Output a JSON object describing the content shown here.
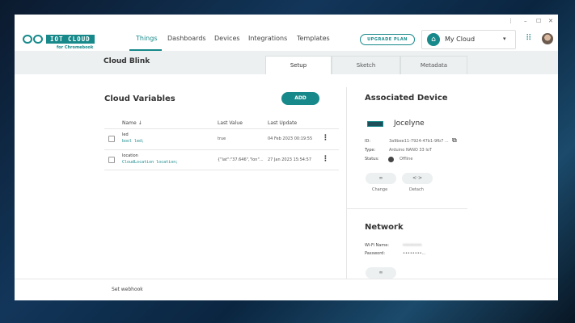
{
  "window": {
    "kebab": "⋮",
    "minimize": "–",
    "maximize": "☐",
    "close": "✕"
  },
  "logo": {
    "text": "IOT CLOUD",
    "sub": "for Chromebook"
  },
  "nav": [
    {
      "label": "Things"
    },
    {
      "label": "Dashboards"
    },
    {
      "label": "Devices"
    },
    {
      "label": "Integrations"
    },
    {
      "label": "Templates"
    }
  ],
  "header": {
    "upgrade": "UPGRADE PLAN",
    "cloud": "My Cloud",
    "caret": "▾",
    "apps": "⠿"
  },
  "thing": {
    "title": "Cloud Blink",
    "tabs": [
      "Setup",
      "Sketch",
      "Metadata"
    ]
  },
  "variables": {
    "title": "Cloud Variables",
    "add": "ADD",
    "columns": [
      "Name ↓",
      "Last Value",
      "Last Update"
    ],
    "rows": [
      {
        "name": "led",
        "code": "bool led;",
        "value": "true",
        "updated": "04 Feb 2023 00:19:55"
      },
      {
        "name": "location",
        "code": "CloudLocation location;",
        "value": "{\"lat\":\"37.646\",\"lon\"...",
        "updated": "27 Jan 2023 15:54:57"
      }
    ]
  },
  "device": {
    "title": "Associated Device",
    "name": "Jocelyne",
    "id_label": "ID:",
    "id": "3a9bee11-7924-47b1-9fb7 ...",
    "type_label": "Type:",
    "type": "Arduino NANO 33 IoT",
    "status_label": "Status:",
    "status": "Offline",
    "change": "Change",
    "detach": "Detach",
    "change_icon": "∞",
    "detach_icon": "<·>"
  },
  "network": {
    "title": "Network",
    "wifi_label": "Wi-Fi Name:",
    "wifi": "••••••••",
    "password_label": "Password:",
    "password": "••••••••..."
  },
  "footer": {
    "webhook": "Set webhook"
  }
}
